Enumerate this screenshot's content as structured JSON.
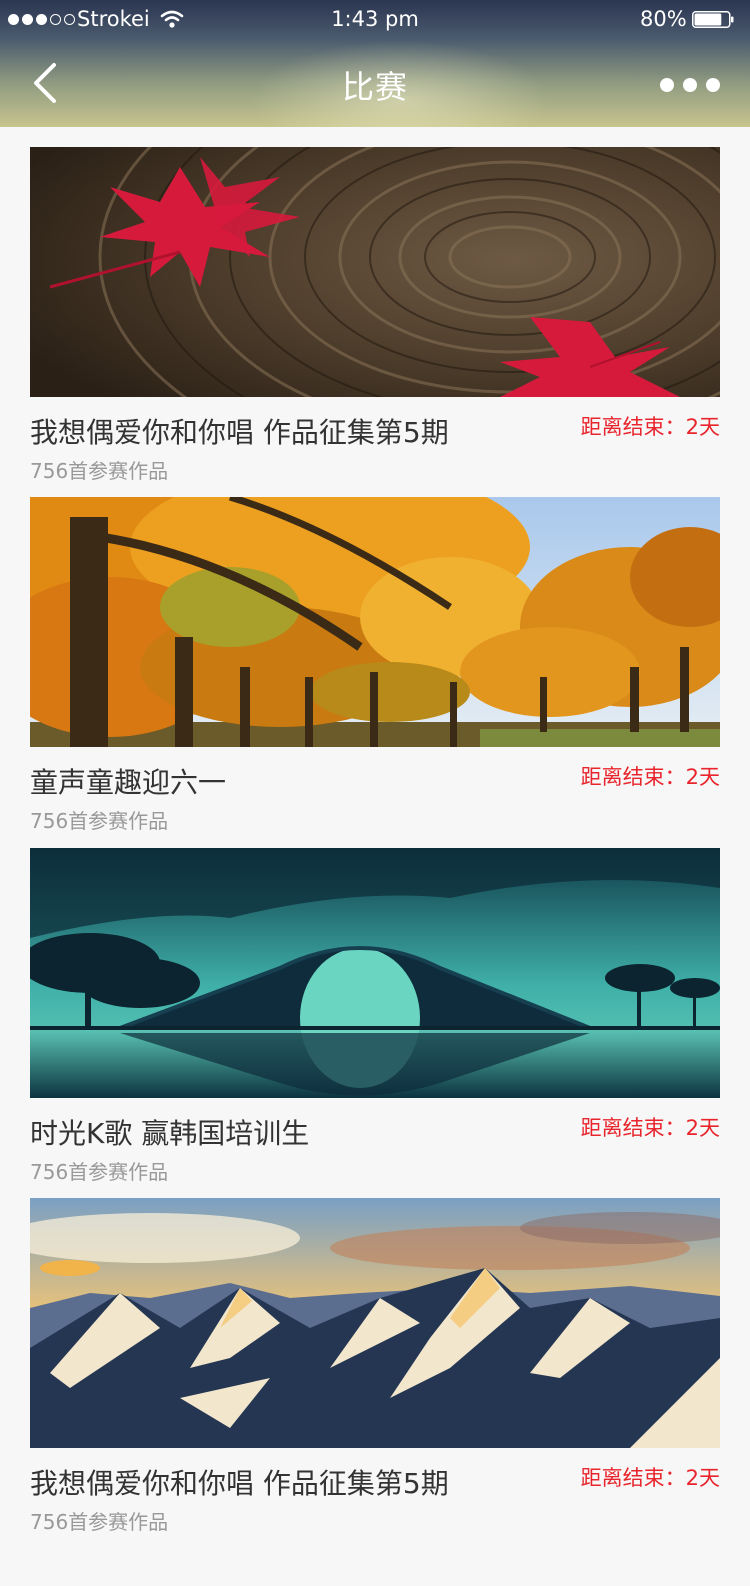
{
  "status_bar": {
    "carrier": "Strokei",
    "time": "1:43 pm",
    "battery": "80%",
    "battery_level": 0.8,
    "signal_bars_filled": 3,
    "signal_bars_total": 5
  },
  "nav": {
    "title": "比赛",
    "back_icon": "chevron-left-icon",
    "more_icon": "more-horizontal-icon"
  },
  "contests": [
    {
      "title": "我想偶爱你和你唱 作品征集第5期",
      "countdown": "距离结束：2天",
      "entries": "756首参赛作品",
      "image": "maple-leaves-on-wood"
    },
    {
      "title": "童声童趣迎六一",
      "countdown": "距离结束：2天",
      "entries": "756首参赛作品",
      "image": "autumn-forest"
    },
    {
      "title": "时光K歌 赢韩国培训生",
      "countdown": "距离结束：2天",
      "entries": "756首参赛作品",
      "image": "arch-bridge-lake"
    },
    {
      "title": "我想偶爱你和你唱 作品征集第5期",
      "countdown": "距离结束：2天",
      "entries": "756首参赛作品",
      "image": "snowy-mountains-sunset"
    }
  ],
  "colors": {
    "countdown": "#e8242c",
    "title": "#333333",
    "subtitle": "#999999",
    "background": "#f7f7f7"
  }
}
